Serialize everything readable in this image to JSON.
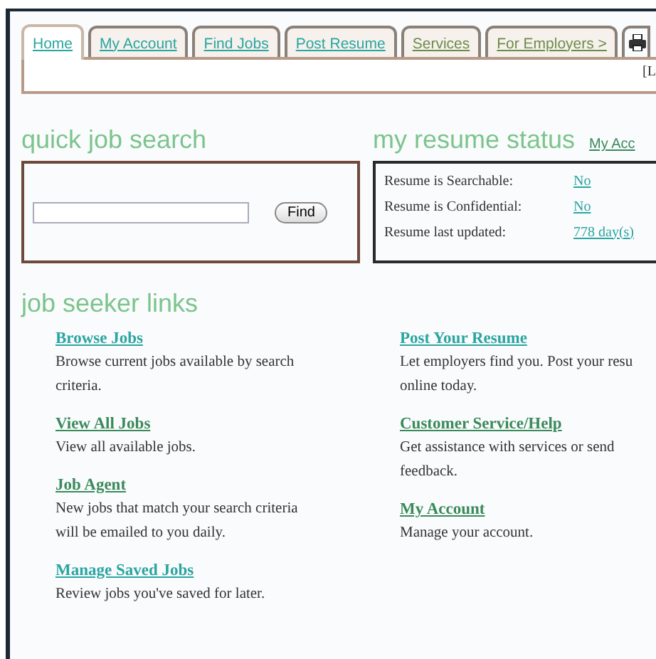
{
  "tabs": [
    {
      "label": "Home",
      "selected": true,
      "visited": false
    },
    {
      "label": "My Account",
      "selected": false,
      "visited": false
    },
    {
      "label": "Find Jobs",
      "selected": false,
      "visited": false
    },
    {
      "label": "Post Resume",
      "selected": false,
      "visited": false
    },
    {
      "label": "Services",
      "selected": false,
      "visited": true
    },
    {
      "label": "For Employers >",
      "selected": false,
      "visited": true
    }
  ],
  "tab_panel": {
    "link": "[L"
  },
  "quick_search": {
    "title": "quick job search",
    "button": "Find"
  },
  "resume_status": {
    "title": "my resume status",
    "link": "My Acc",
    "rows": [
      {
        "label": "Resume is Searchable:",
        "value": "No"
      },
      {
        "label": "Resume is Confidential:",
        "value": "No"
      },
      {
        "label": "Resume last updated:",
        "value": "778 day(s)"
      }
    ]
  },
  "job_seeker_links": {
    "title": "job seeker links",
    "columns": [
      [
        {
          "title": "Browse Jobs",
          "visited": false,
          "lines": [
            "Browse current jobs available by search",
            "criteria."
          ]
        },
        {
          "title": "View All Jobs",
          "visited": true,
          "lines": [
            "View all available jobs."
          ]
        },
        {
          "title": "Job Agent",
          "visited": true,
          "lines": [
            "New jobs that match your search criteria",
            "will be emailed to you daily."
          ]
        },
        {
          "title": "Manage Saved Jobs",
          "visited": false,
          "lines": [
            "Review jobs you've saved for later."
          ]
        }
      ],
      [
        {
          "title": "Post Your Resume",
          "visited": false,
          "lines": [
            "Let employers find you. Post your resu",
            "online today."
          ]
        },
        {
          "title": "Customer Service/Help",
          "visited": true,
          "lines": [
            "Get assistance with services or send",
            "feedback."
          ]
        },
        {
          "title": "My Account",
          "visited": true,
          "lines": [
            "Manage your account."
          ]
        }
      ]
    ]
  }
}
